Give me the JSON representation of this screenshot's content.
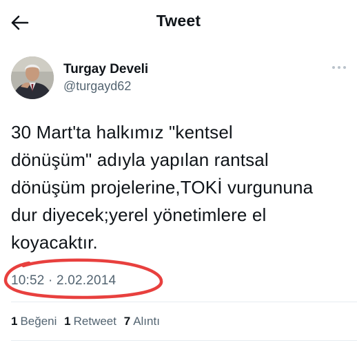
{
  "header": {
    "title": "Tweet",
    "back_icon": "arrow-left-icon"
  },
  "author": {
    "name": "Turgay Develi",
    "handle": "@turgayd62",
    "more_icon": "more-horizontal-icon"
  },
  "tweet": {
    "text_lines": [
      "30 Mart'ta halkımız \"kentsel",
      "dönüşüm\" adıyla yapılan rantsal",
      "dönüşüm projelerine,TOKİ vurgununa",
      "dur diyecek;yerel yönetimlere el",
      "koyacaktır."
    ],
    "timestamp": "10:52 · 2.02.2014"
  },
  "stats": {
    "likes_count": "1",
    "likes_label": "Beğeni",
    "retweets_count": "1",
    "retweets_label": "Retweet",
    "quotes_count": "7",
    "quotes_label": "Alıntı"
  },
  "colors": {
    "text": "#0f1419",
    "secondary": "#536471",
    "annotation_circle": "#e8403e",
    "divider": "#e6ecf0"
  }
}
